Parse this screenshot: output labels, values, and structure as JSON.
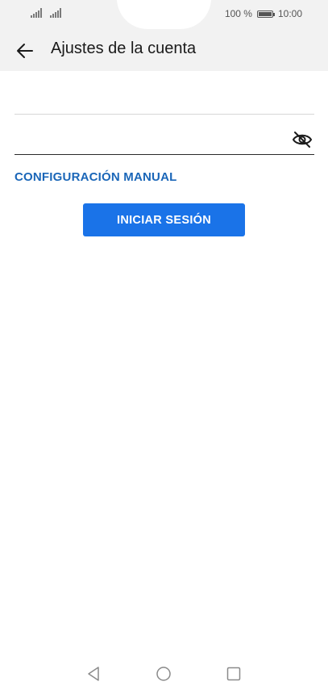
{
  "status_bar": {
    "battery_percent": "100 %",
    "battery_level": 1.0,
    "time": "10:00"
  },
  "header": {
    "title": "Ajustes de la cuenta",
    "back_icon": "arrow-left-icon"
  },
  "form": {
    "field1_value": "",
    "field2_value": "",
    "visibility_icon": "eye-off-icon",
    "manual_link": "CONFIGURACIÓN MANUAL",
    "login_button": "INICIAR SESIÓN"
  },
  "colors": {
    "accent": "#1a73e8",
    "link": "#1a66b8",
    "header_bg": "#f2f2f2"
  },
  "navigation": {
    "icons": [
      "triangle-back-icon",
      "circle-home-icon",
      "square-recent-icon"
    ]
  }
}
